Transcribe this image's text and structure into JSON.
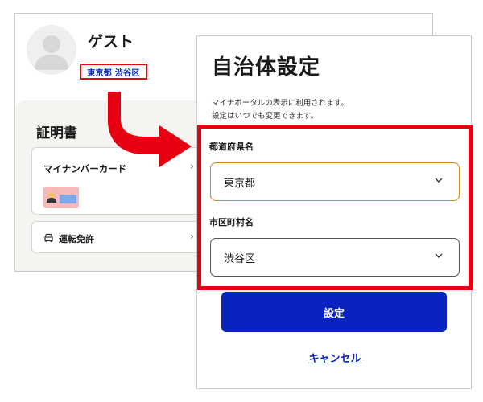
{
  "profile": {
    "name": "ゲスト",
    "region": "東京都 渋谷区"
  },
  "certificates": {
    "title": "証明書",
    "items": [
      {
        "label": "マイナンバーカード",
        "icon": "id-card-icon"
      },
      {
        "label": "運転免許",
        "icon": "car-icon"
      }
    ]
  },
  "modal": {
    "title": "自治体設定",
    "description_line1": "マイナポータルの表示に利用されます。",
    "description_line2": "設定はいつでも変更できます。",
    "prefecture": {
      "label": "都道府県名",
      "value": "東京都"
    },
    "municipality": {
      "label": "市区町村名",
      "value": "渋谷区"
    },
    "submit_label": "設定",
    "cancel_label": "キャンセル"
  },
  "colors": {
    "highlight": "#e60012",
    "primary": "#0a23be",
    "focus_border": "#d48c17"
  }
}
